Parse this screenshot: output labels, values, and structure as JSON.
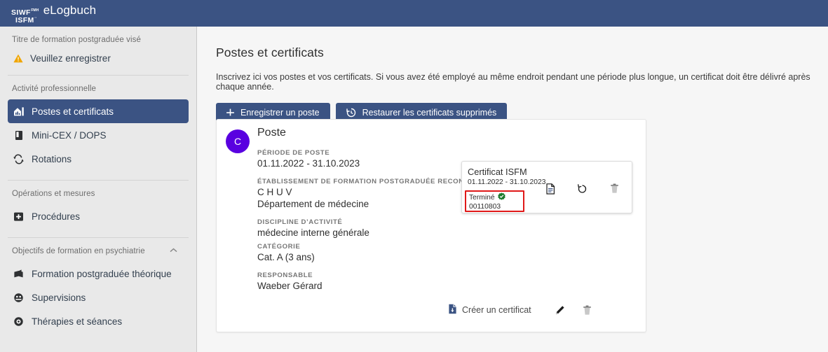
{
  "header": {
    "brand_line1": "SIWF",
    "brand_line1_sup": "FMH",
    "brand_line2": "ISFM",
    "brand_line2_sup": "··",
    "app_name": "eLogbuch"
  },
  "sidebar": {
    "section_title_label": "Titre de formation postgraduée visé",
    "warning_text": "Veuillez enregistrer",
    "section_activity_label": "Activité professionnelle",
    "activity_items": [
      {
        "label": "Postes et certificats",
        "icon": "home-chart-icon",
        "active": true
      },
      {
        "label": "Mini-CEX / DOPS",
        "icon": "clipboard-icon",
        "active": false
      },
      {
        "label": "Rotations",
        "icon": "refresh-icon",
        "active": false
      }
    ],
    "section_operations_label": "Opérations et mesures",
    "operations_items": [
      {
        "label": "Procédures",
        "icon": "plus-square-icon",
        "active": false
      }
    ],
    "section_objectives_label": "Objectifs de formation en psychiatrie",
    "objectives_items": [
      {
        "label": "Formation postgraduée théorique",
        "icon": "book-icon",
        "active": false
      },
      {
        "label": "Supervisions",
        "icon": "supervision-icon",
        "active": false
      },
      {
        "label": "Thérapies et séances",
        "icon": "therapy-icon",
        "active": false
      }
    ]
  },
  "main": {
    "page_title": "Postes et certificats",
    "page_description": "Inscrivez ici vos postes et vos certificats. Si vous avez été employé au même endroit pendant une période plus longue, un certificat doit être délivré après chaque année.",
    "buttons": {
      "add_post": "Enregistrer un poste",
      "restore_certs": "Restaurer les certificats supprimés"
    },
    "card": {
      "avatar_letter": "C",
      "title": "Poste",
      "fields": [
        {
          "label": "PÉRIODE DE POSTE",
          "value": "01.11.2022 - 31.10.2023"
        },
        {
          "label": "ÉTABLISSEMENT DE FORMATION POSTGRADUÉE RECONNU",
          "value": "C H U V",
          "value2": "Département de médecine"
        },
        {
          "label": "DISCIPLINE D’ACTIVITÉ",
          "value": "médecine interne générale"
        },
        {
          "label": "CATÉGORIE",
          "value": "Cat. A (3 ans)"
        },
        {
          "label": "RESPONSABLE",
          "value": "Waeber Gérard"
        }
      ],
      "certificate": {
        "title": "Certificat ISFM",
        "dates": "01.11.2022 - 31.10.2023",
        "status": "Terminé",
        "number": "00110803",
        "actions": [
          "document-icon",
          "restore-icon",
          "trash-icon"
        ],
        "highlight_color": "#e01818"
      },
      "footer": {
        "create_certificate": "Créer un certificat",
        "actions": [
          "edit-pencil-icon",
          "trash-icon"
        ]
      }
    }
  },
  "colors": {
    "brand_blue": "#3b5383",
    "avatar_purple": "#5900e0",
    "warning_amber": "#f0a500",
    "status_green": "#1e7a2e",
    "highlight_red": "#e01818"
  }
}
